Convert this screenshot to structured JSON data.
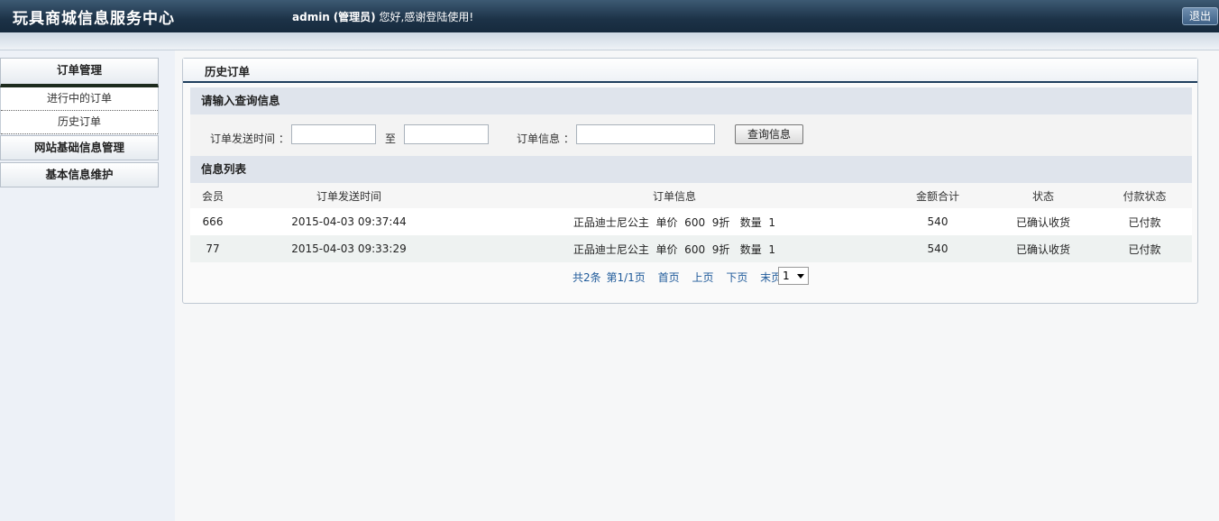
{
  "header": {
    "brand": "玩具商城信息服务中心",
    "user": "admin",
    "role": "(管理员)",
    "greeting": "您好,感谢登陆使用!",
    "logout": "退出"
  },
  "sidebar": {
    "sections": [
      {
        "label": "订单管理",
        "items": [
          {
            "label": "进行中的订单"
          },
          {
            "label": "历史订单"
          }
        ]
      },
      {
        "label": "网站基础信息管理"
      },
      {
        "label": "基本信息维护"
      }
    ]
  },
  "main": {
    "title": "历史订单",
    "query": {
      "heading": "请输入查询信息",
      "send_time_label": "订单发送时间 ：",
      "to_label": "至",
      "info_label": "订单信息 ：",
      "submit": "查询信息"
    },
    "list": {
      "heading": "信息列表",
      "columns": [
        "会员",
        "订单发送时间",
        "订单信息",
        "金额合计",
        "状态",
        "付款状态"
      ],
      "rows": [
        [
          "666",
          "2015-04-03 09:37:44",
          "正品迪士尼公主  单价  600  9折   数量  1",
          "540",
          "已确认收货",
          "已付款"
        ],
        [
          "77",
          "2015-04-03 09:33:29",
          "正品迪士尼公主  单价  600  9折   数量  1",
          "540",
          "已确认收货",
          "已付款"
        ]
      ]
    },
    "pager": {
      "summary": "共2条",
      "page_info": "第1/1页",
      "first": "首页",
      "prev": "上页",
      "next": "下页",
      "last": "末页",
      "current": "1"
    }
  }
}
